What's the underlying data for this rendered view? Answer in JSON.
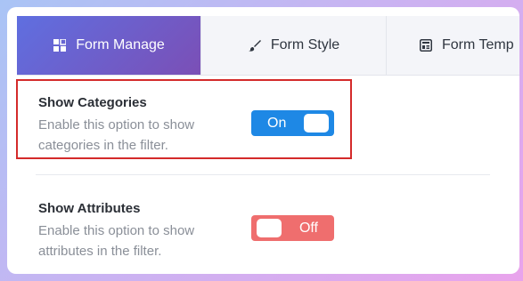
{
  "tabs": [
    {
      "label": "Form Manage",
      "icon": "grid-icon",
      "active": true
    },
    {
      "label": "Form Style",
      "icon": "brush-icon",
      "active": false
    },
    {
      "label": "Form Temp",
      "icon": "template-icon",
      "active": false
    }
  ],
  "settings": [
    {
      "title": "Show Categories",
      "description": "Enable this option to show categories in the filter.",
      "toggle": {
        "state": "On",
        "color": "#1e88e5"
      }
    },
    {
      "title": "Show Attributes",
      "description": "Enable this option to show attributes in the filter.",
      "toggle": {
        "state": "Off",
        "color": "#ef6e6e"
      }
    }
  ],
  "colors": {
    "active_tab_start": "#5f6fe0",
    "active_tab_end": "#7b4fb6",
    "highlight_border": "#d42a2a"
  }
}
